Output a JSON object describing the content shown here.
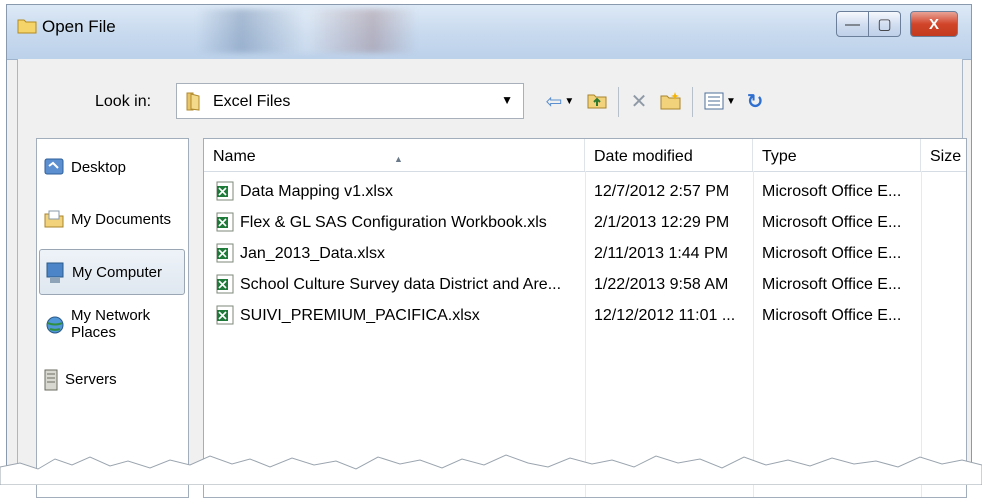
{
  "window": {
    "title": "Open File",
    "controls": {
      "minimize": "—",
      "maximize": "▢",
      "close": "X"
    }
  },
  "look_in": {
    "label": "Look in:",
    "value": "Excel Files"
  },
  "toolbar": {
    "icons": [
      "back-arrow-icon",
      "up-folder-icon",
      "delete-icon",
      "new-folder-icon",
      "views-icon",
      "refresh-icon"
    ]
  },
  "places": [
    {
      "label": "Desktop",
      "icon": "desktop-icon"
    },
    {
      "label": "My Documents",
      "icon": "my-documents-icon"
    },
    {
      "label": "My Computer",
      "icon": "my-computer-icon",
      "selected": true
    },
    {
      "label": "My Network Places",
      "icon": "network-places-icon"
    },
    {
      "label": "Servers",
      "icon": "servers-icon"
    }
  ],
  "columns": [
    "Name",
    "Date modified",
    "Type",
    "Size"
  ],
  "files": [
    {
      "name": "Data Mapping v1.xlsx",
      "date": "12/7/2012 2:57 PM",
      "type": "Microsoft Office E..."
    },
    {
      "name": "Flex & GL SAS Configuration Workbook.xls",
      "date": "2/1/2013 12:29 PM",
      "type": "Microsoft Office E..."
    },
    {
      "name": "Jan_2013_Data.xlsx",
      "date": "2/11/2013 1:44 PM",
      "type": "Microsoft Office E..."
    },
    {
      "name": "School Culture Survey data  District and Are...",
      "date": "1/22/2013 9:58 AM",
      "type": "Microsoft Office E..."
    },
    {
      "name": "SUIVI_PREMIUM_PACIFICA.xlsx",
      "date": "12/12/2012 11:01 ...",
      "type": "Microsoft Office E..."
    }
  ],
  "colors": {
    "title_bar": "#c7d9ee",
    "close_button": "#d1452b",
    "selection": "#dfe7f0",
    "excel_green": "#1f7a3a"
  }
}
